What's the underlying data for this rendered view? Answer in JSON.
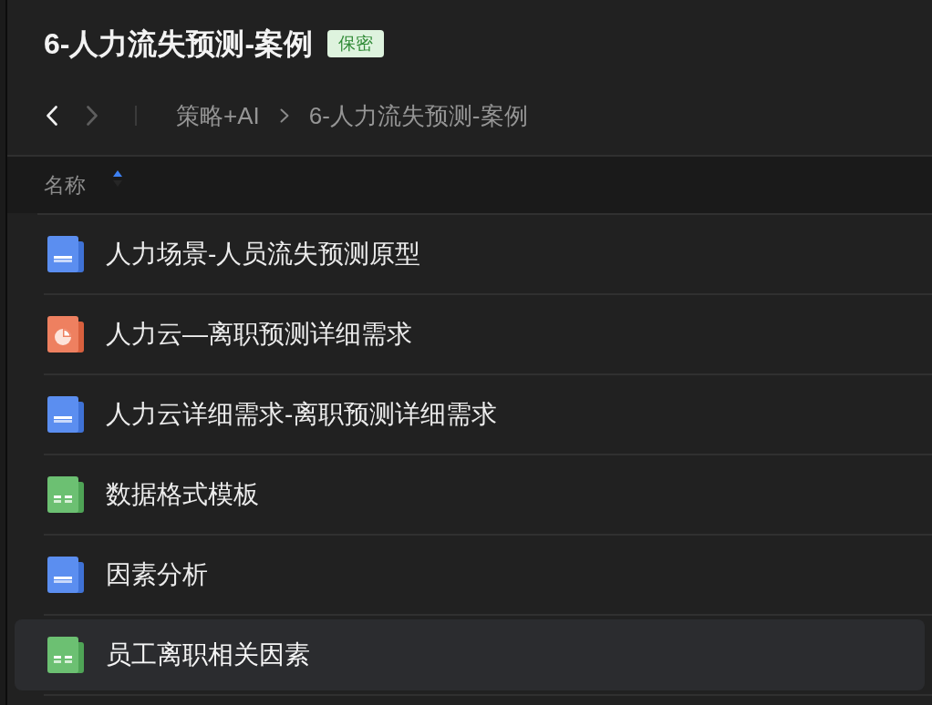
{
  "title": "6-人力流失预测-案例",
  "tag": "保密",
  "nav": {
    "back": {
      "disabled": false
    },
    "forward": {
      "disabled": true
    }
  },
  "breadcrumb": [
    "策略+AI",
    "6-人力流失预测-案例"
  ],
  "table": {
    "columns": [
      {
        "label": "名称",
        "sort_ascending": true
      }
    ],
    "rows": [
      {
        "name": "人力场景-人员流失预测原型",
        "kind": "doc",
        "selected": false
      },
      {
        "name": "人力云—离职预测详细需求",
        "kind": "slides",
        "selected": false
      },
      {
        "name": "人力云详细需求-离职预测详细需求",
        "kind": "doc",
        "selected": false
      },
      {
        "name": "数据格式模板",
        "kind": "sheet",
        "selected": false
      },
      {
        "name": "因素分析",
        "kind": "doc",
        "selected": false
      },
      {
        "name": "员工离职相关因素",
        "kind": "sheet",
        "selected": true
      }
    ]
  }
}
